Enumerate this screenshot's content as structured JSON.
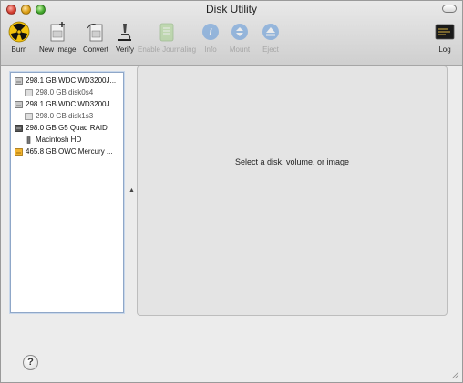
{
  "window": {
    "title": "Disk Utility"
  },
  "toolbar": {
    "burn": "Burn",
    "new_image": "New Image",
    "convert": "Convert",
    "verify": "Verify",
    "enable_journaling": "Enable Journaling",
    "info": "Info",
    "mount": "Mount",
    "eject": "Eject",
    "log": "Log"
  },
  "sidebar": {
    "items": [
      {
        "label": "298.1 GB WDC WD3200J...",
        "level": 0,
        "icon": "hard-disk-icon"
      },
      {
        "label": "298.0 GB disk0s4",
        "level": 1,
        "icon": "volume-icon"
      },
      {
        "label": "298.1 GB WDC WD3200J...",
        "level": 0,
        "icon": "hard-disk-icon"
      },
      {
        "label": "298.0 GB disk1s3",
        "level": 1,
        "icon": "volume-icon"
      },
      {
        "label": "298.0 GB G5 Quad RAID",
        "level": 0,
        "icon": "raid-disk-icon"
      },
      {
        "label": "Macintosh HD",
        "level": 1,
        "icon": "volume-icon"
      },
      {
        "label": "465.8 GB OWC Mercury ...",
        "level": 0,
        "icon": "external-disk-icon"
      }
    ]
  },
  "main": {
    "message": "Select a disk, volume, or image"
  },
  "colors": {
    "accent": "#8fa7c8",
    "burn_yellow": "#f3c20d",
    "info_blue": "#3f86d9"
  }
}
